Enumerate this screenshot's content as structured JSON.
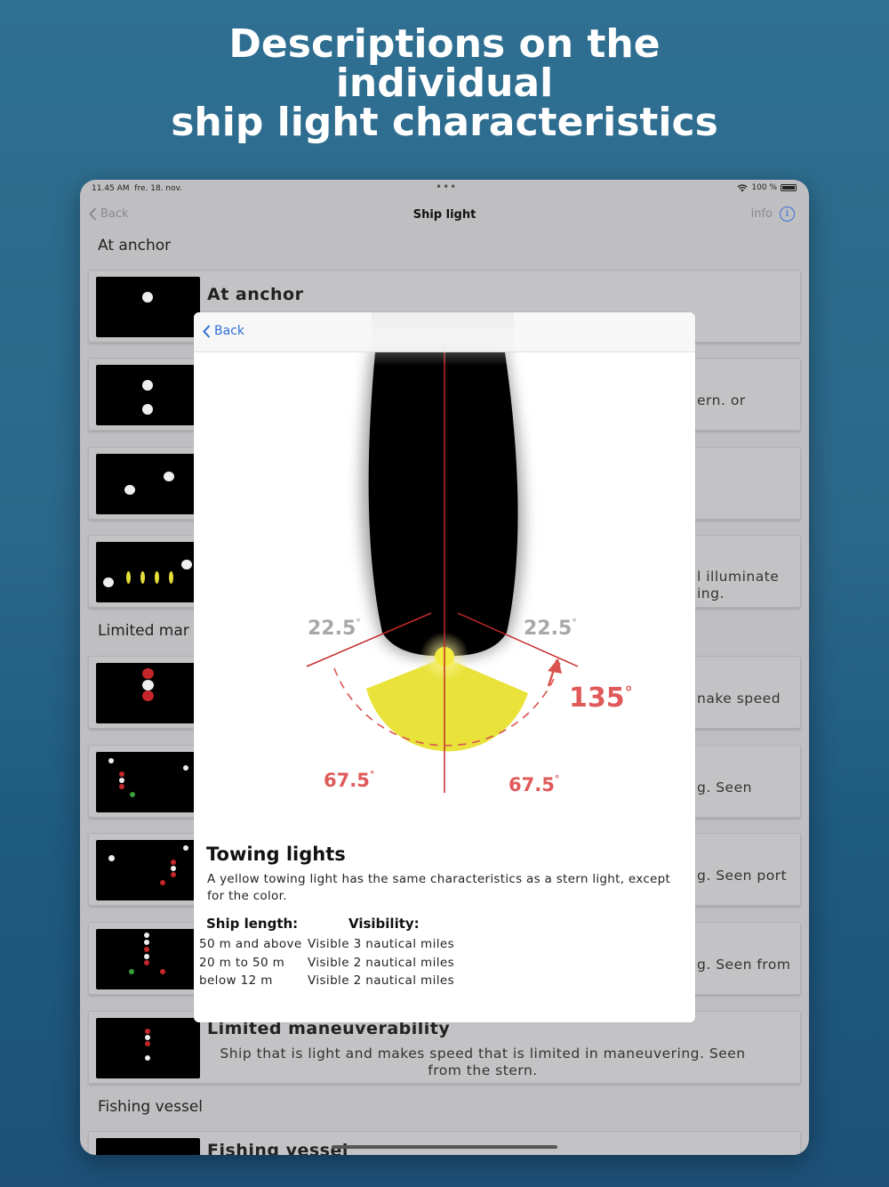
{
  "headline": {
    "line1": "Descriptions on the",
    "line2": "individual",
    "line3": "ship light characteristics"
  },
  "status_bar": {
    "time": "11.45 AM",
    "date": "fre. 18. nov.",
    "battery": "100 %"
  },
  "nav": {
    "back_label": "Back",
    "title": "Ship light",
    "info_label": "info"
  },
  "sections": {
    "at_anchor": "At anchor",
    "limited_partial": "Limited mar",
    "fishing": "Fishing vessel"
  },
  "rows": {
    "r1_title": "At anchor",
    "r2_text": "ern. or",
    "r4_text1": "l illuminate",
    "r4_text2": "ing.",
    "r5_text": "nake speed",
    "r6_text": "g. Seen",
    "r7_text": "g. Seen port",
    "r8_text": "g. Seen from",
    "r9_title": "Limited maneuverability",
    "r9_desc": "Ship that is light and makes speed that is limited in maneuvering.  Seen from the stern.",
    "r10_title": "Fishing vessel"
  },
  "modal": {
    "back_label": "Back",
    "angle_left_top": "22.5",
    "angle_right_top": "22.5",
    "angle_left_bottom": "67.5",
    "angle_right_bottom": "67.5",
    "arc_angle": "135",
    "degree": "°",
    "title": "Towing lights",
    "description": "A yellow towing light has the same characteristics as a stern light, except for the color.",
    "col_length": "Ship length:",
    "col_visibility": "Visibility:",
    "specs": [
      {
        "length": "50 m and above",
        "visibility": "Visible 3 nautical miles"
      },
      {
        "length": "20 m to 50 m",
        "visibility": "Visible 2 nautical miles"
      },
      {
        "length": "below 12 m",
        "visibility": "Visible 2 nautical miles"
      }
    ]
  },
  "colors": {
    "accent_blue": "#2f6ed8",
    "angle_red": "#d9534f",
    "towing_yellow": "#e8e23a"
  }
}
